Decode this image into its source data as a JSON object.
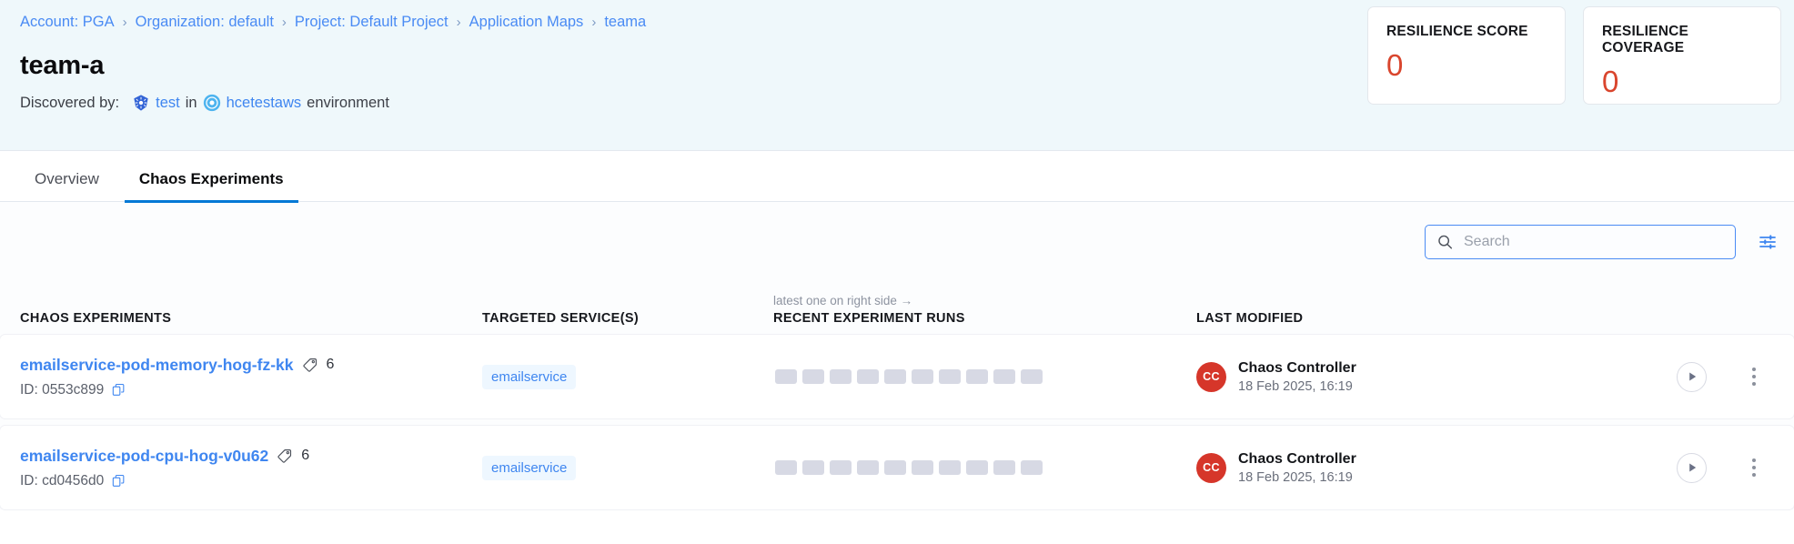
{
  "breadcrumb": {
    "items": [
      {
        "label": "Account: PGA"
      },
      {
        "label": "Organization: default"
      },
      {
        "label": "Project: Default Project"
      },
      {
        "label": "Application Maps"
      },
      {
        "label": "teama"
      }
    ],
    "separator": "›"
  },
  "header": {
    "title": "team-a",
    "discovered_label": "Discovered by:",
    "agent_name": "test",
    "in_word": "in",
    "environment_name": "hcetestaws",
    "environment_word": "environment",
    "agent_icon": "kubernetes-icon",
    "environment_icon": "cloud-environment-icon"
  },
  "score_cards": [
    {
      "label": "RESILIENCE SCORE",
      "value": "0",
      "color": "#d9452d"
    },
    {
      "label": "RESILIENCE COVERAGE",
      "value": "0",
      "color": "#d9452d"
    }
  ],
  "tabs": [
    {
      "label": "Overview",
      "active": false
    },
    {
      "label": "Chaos Experiments",
      "active": true
    }
  ],
  "toolbar": {
    "search_placeholder": "Search",
    "search_value": "",
    "search_icon": "search-icon",
    "filter_icon": "filter-sliders-icon"
  },
  "table": {
    "headers": {
      "name": "CHAOS EXPERIMENTS",
      "target": "TARGETED SERVICE(S)",
      "runs": "RECENT EXPERIMENT RUNS",
      "runs_hint": "latest one on right side →",
      "modified": "LAST MODIFIED"
    },
    "rows": [
      {
        "name": "emailservice-pod-memory-hog-fz-kk",
        "tag_count": "6",
        "id_label": "ID: 0553c899",
        "service": "emailservice",
        "runs": [
          "idle",
          "idle",
          "idle",
          "idle",
          "idle",
          "idle",
          "idle",
          "idle",
          "idle",
          "idle"
        ],
        "modified_initials": "CC",
        "modified_by": "Chaos Controller",
        "modified_at": "18 Feb 2025, 16:19",
        "run_button": "run-experiment",
        "menu_button": "row-menu"
      },
      {
        "name": "emailservice-pod-cpu-hog-v0u62",
        "tag_count": "6",
        "id_label": "ID: cd0456d0",
        "service": "emailservice",
        "runs": [
          "idle",
          "idle",
          "idle",
          "idle",
          "idle",
          "idle",
          "idle",
          "idle",
          "idle",
          "idle"
        ],
        "modified_initials": "CC",
        "modified_by": "Chaos Controller",
        "modified_at": "18 Feb 2025, 16:19",
        "run_button": "run-experiment",
        "menu_button": "row-menu"
      }
    ]
  },
  "colors": {
    "link": "#3f86f0",
    "accent": "#0278d5",
    "danger": "#d9452d",
    "header_bg": "#eff8fb",
    "run_bar": "#d7d9e4"
  }
}
